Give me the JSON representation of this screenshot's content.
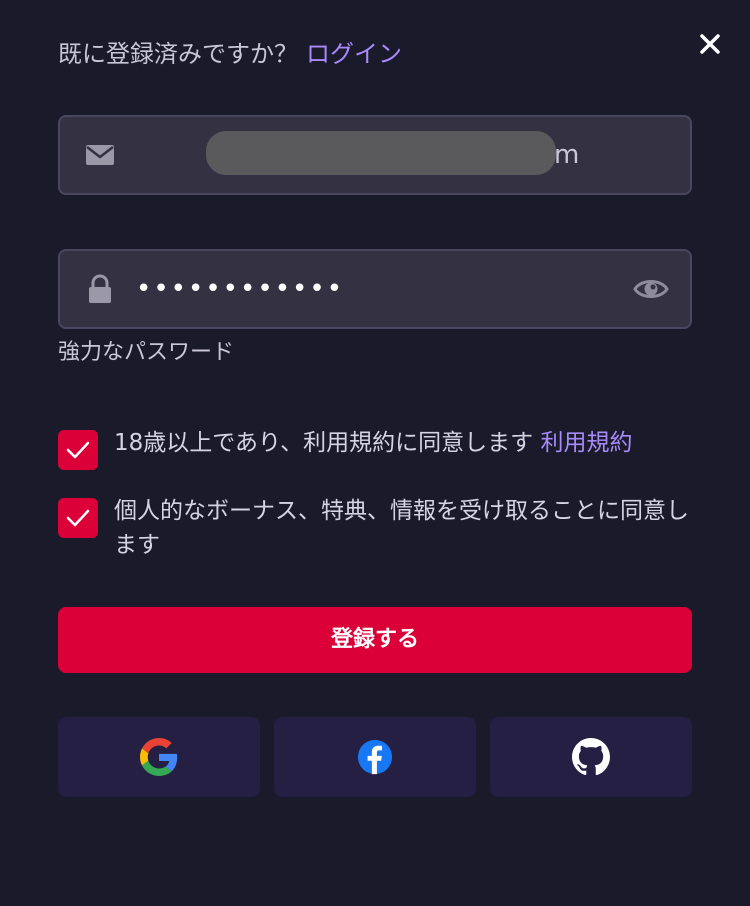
{
  "header": {
    "prompt": "既に登録済みですか？",
    "login_link": "ログイン"
  },
  "close_icon": "close-icon",
  "email_field": {
    "icon": "mail-icon",
    "value_suffix": "m"
  },
  "password_field": {
    "icon": "lock-icon",
    "masked_value": "••••••••••••",
    "toggle_icon": "eye-icon"
  },
  "password_strength": "強力なパスワード",
  "checkboxes": [
    {
      "checked": true,
      "text": "18歳以上であり、利用規約に同意します",
      "link": "利用規約"
    },
    {
      "checked": true,
      "text": "個人的なボーナス、特典、情報を受け取ることに同意します"
    }
  ],
  "register_button": "登録する",
  "social_buttons": [
    {
      "icon": "google-icon"
    },
    {
      "icon": "facebook-icon"
    },
    {
      "icon": "github-icon"
    }
  ],
  "colors": {
    "background": "#1b1a2b",
    "accent_link": "#a78bfa",
    "primary_button": "#dc0038",
    "input_background": "#343142",
    "social_button_background": "#241f43"
  }
}
